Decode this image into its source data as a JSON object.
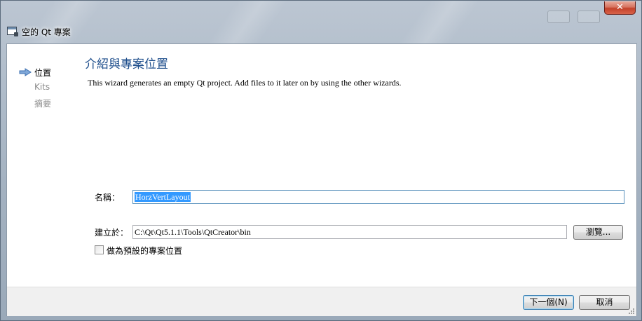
{
  "window": {
    "title": "空的 Qt 專案",
    "close_glyph": "✕"
  },
  "nav": {
    "items": [
      {
        "label": "位置",
        "active": true
      },
      {
        "label": "Kits",
        "active": false
      },
      {
        "label": "摘要",
        "active": false
      }
    ]
  },
  "page": {
    "title": "介紹與專案位置",
    "description": "This wizard generates an empty Qt project. Add files to it later on by using the other wizards."
  },
  "form": {
    "name_label": "名稱：",
    "name_value": "HorzVertLayout",
    "location_label": "建立於：",
    "location_value": "C:\\Qt\\Qt5.1.1\\Tools\\QtCreator\\bin",
    "browse_label": "瀏覽...",
    "default_checkbox_label": "做為預設的專案位置",
    "default_checked": false
  },
  "footer": {
    "next_label": "下一個(N)",
    "cancel_label": "取消"
  },
  "colors": {
    "title_accent": "#1e4e8c",
    "selection": "#3399ff",
    "arrow": "#4a7fc1"
  },
  "icons": {
    "window": "window-icon",
    "nav_arrow": "arrow-right-icon",
    "close": "close-icon"
  }
}
